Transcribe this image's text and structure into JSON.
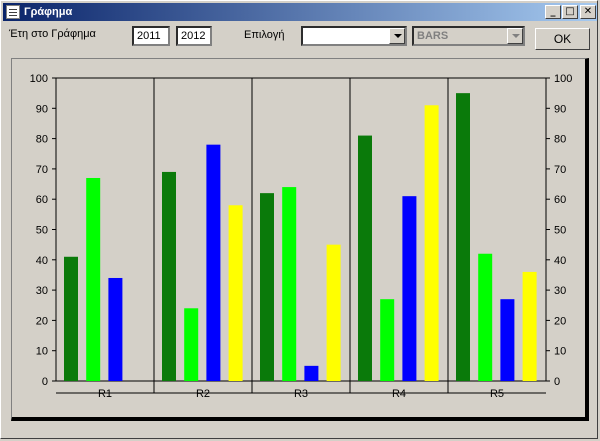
{
  "window": {
    "title": "Γράφημα"
  },
  "toolbar": {
    "years_label": "Έτη στο Γράφημα",
    "year_from": "2011",
    "year_to": "2012",
    "option_label": "Επιλογή",
    "option_value": "",
    "type_value": "BARS",
    "ok_label": "OK"
  },
  "colors": {
    "series1": "#0a7a0a",
    "series2": "#00ff00",
    "series3": "#0000ff",
    "series4": "#ffff00"
  },
  "chart_data": {
    "type": "bar",
    "categories": [
      "R1",
      "R2",
      "R3",
      "R4",
      "R5"
    ],
    "series": [
      {
        "color": "#0a7a0a",
        "values": [
          41,
          69,
          62,
          81,
          95
        ]
      },
      {
        "color": "#00ff00",
        "values": [
          67,
          24,
          64,
          27,
          42
        ]
      },
      {
        "color": "#0000ff",
        "values": [
          34,
          78,
          5,
          61,
          27
        ]
      },
      {
        "color": "#ffff00",
        "values": [
          0,
          58,
          45,
          91,
          36
        ]
      }
    ],
    "ylim": [
      0,
      100
    ],
    "yticks": [
      0,
      10,
      20,
      30,
      40,
      50,
      60,
      70,
      80,
      90,
      100
    ],
    "grid": "vertical category separators",
    "legend": "none"
  }
}
